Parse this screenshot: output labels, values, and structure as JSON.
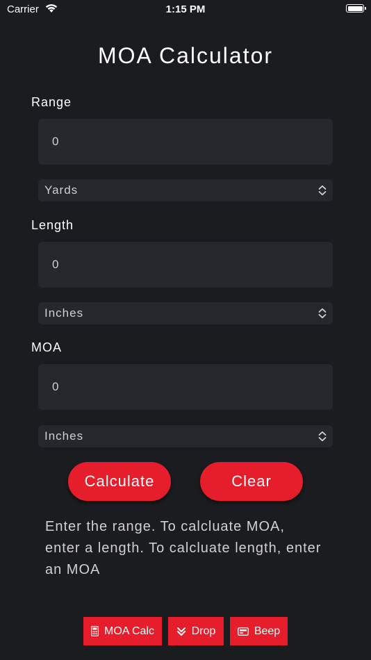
{
  "status_bar": {
    "carrier": "Carrier",
    "time": "1:15 PM"
  },
  "title": "MOA Calculator",
  "form": {
    "range": {
      "label": "Range",
      "value": "0",
      "unit": "Yards"
    },
    "length": {
      "label": "Length",
      "value": "0",
      "unit": "Inches"
    },
    "moa": {
      "label": "MOA",
      "value": "0",
      "unit": "Inches"
    }
  },
  "buttons": {
    "calculate": "Calculate",
    "clear": "Clear"
  },
  "help_text": "Enter the range. To calcluate MOA, enter a length. To calcluate length, enter an MOA",
  "tabs": [
    {
      "label": "MOA Calc",
      "icon": "calculator-icon"
    },
    {
      "label": "Drop",
      "icon": "double-chevron-down-icon"
    },
    {
      "label": "Beep",
      "icon": "pager-icon"
    }
  ],
  "colors": {
    "background": "#1b1c1f",
    "field": "#26272d",
    "accent": "#e61e2b"
  }
}
